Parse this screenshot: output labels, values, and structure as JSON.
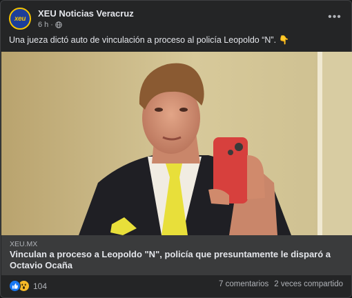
{
  "page": {
    "name": "XEU Noticias Veracruz",
    "avatar_text": "xeu",
    "time": "6 h",
    "separator": "·",
    "more": "•••"
  },
  "post": {
    "caption": "Una jueza dictó auto de vinculación a proceso al policía Leopoldo “N”. 👇"
  },
  "link": {
    "domain": "XEU.MX",
    "title": "Vinculan a proceso a Leopoldo \"N\", policía que presuntamente le disparó a Octavio Ocaña"
  },
  "footer": {
    "reaction_count": "104",
    "comments": "7 comentarios",
    "shares": "2 veces compartido"
  },
  "colors": {
    "card_bg": "#242526",
    "link_bg": "#3a3b3c",
    "like_blue": "#1877f2",
    "wow_yellow": "#f7b928"
  }
}
